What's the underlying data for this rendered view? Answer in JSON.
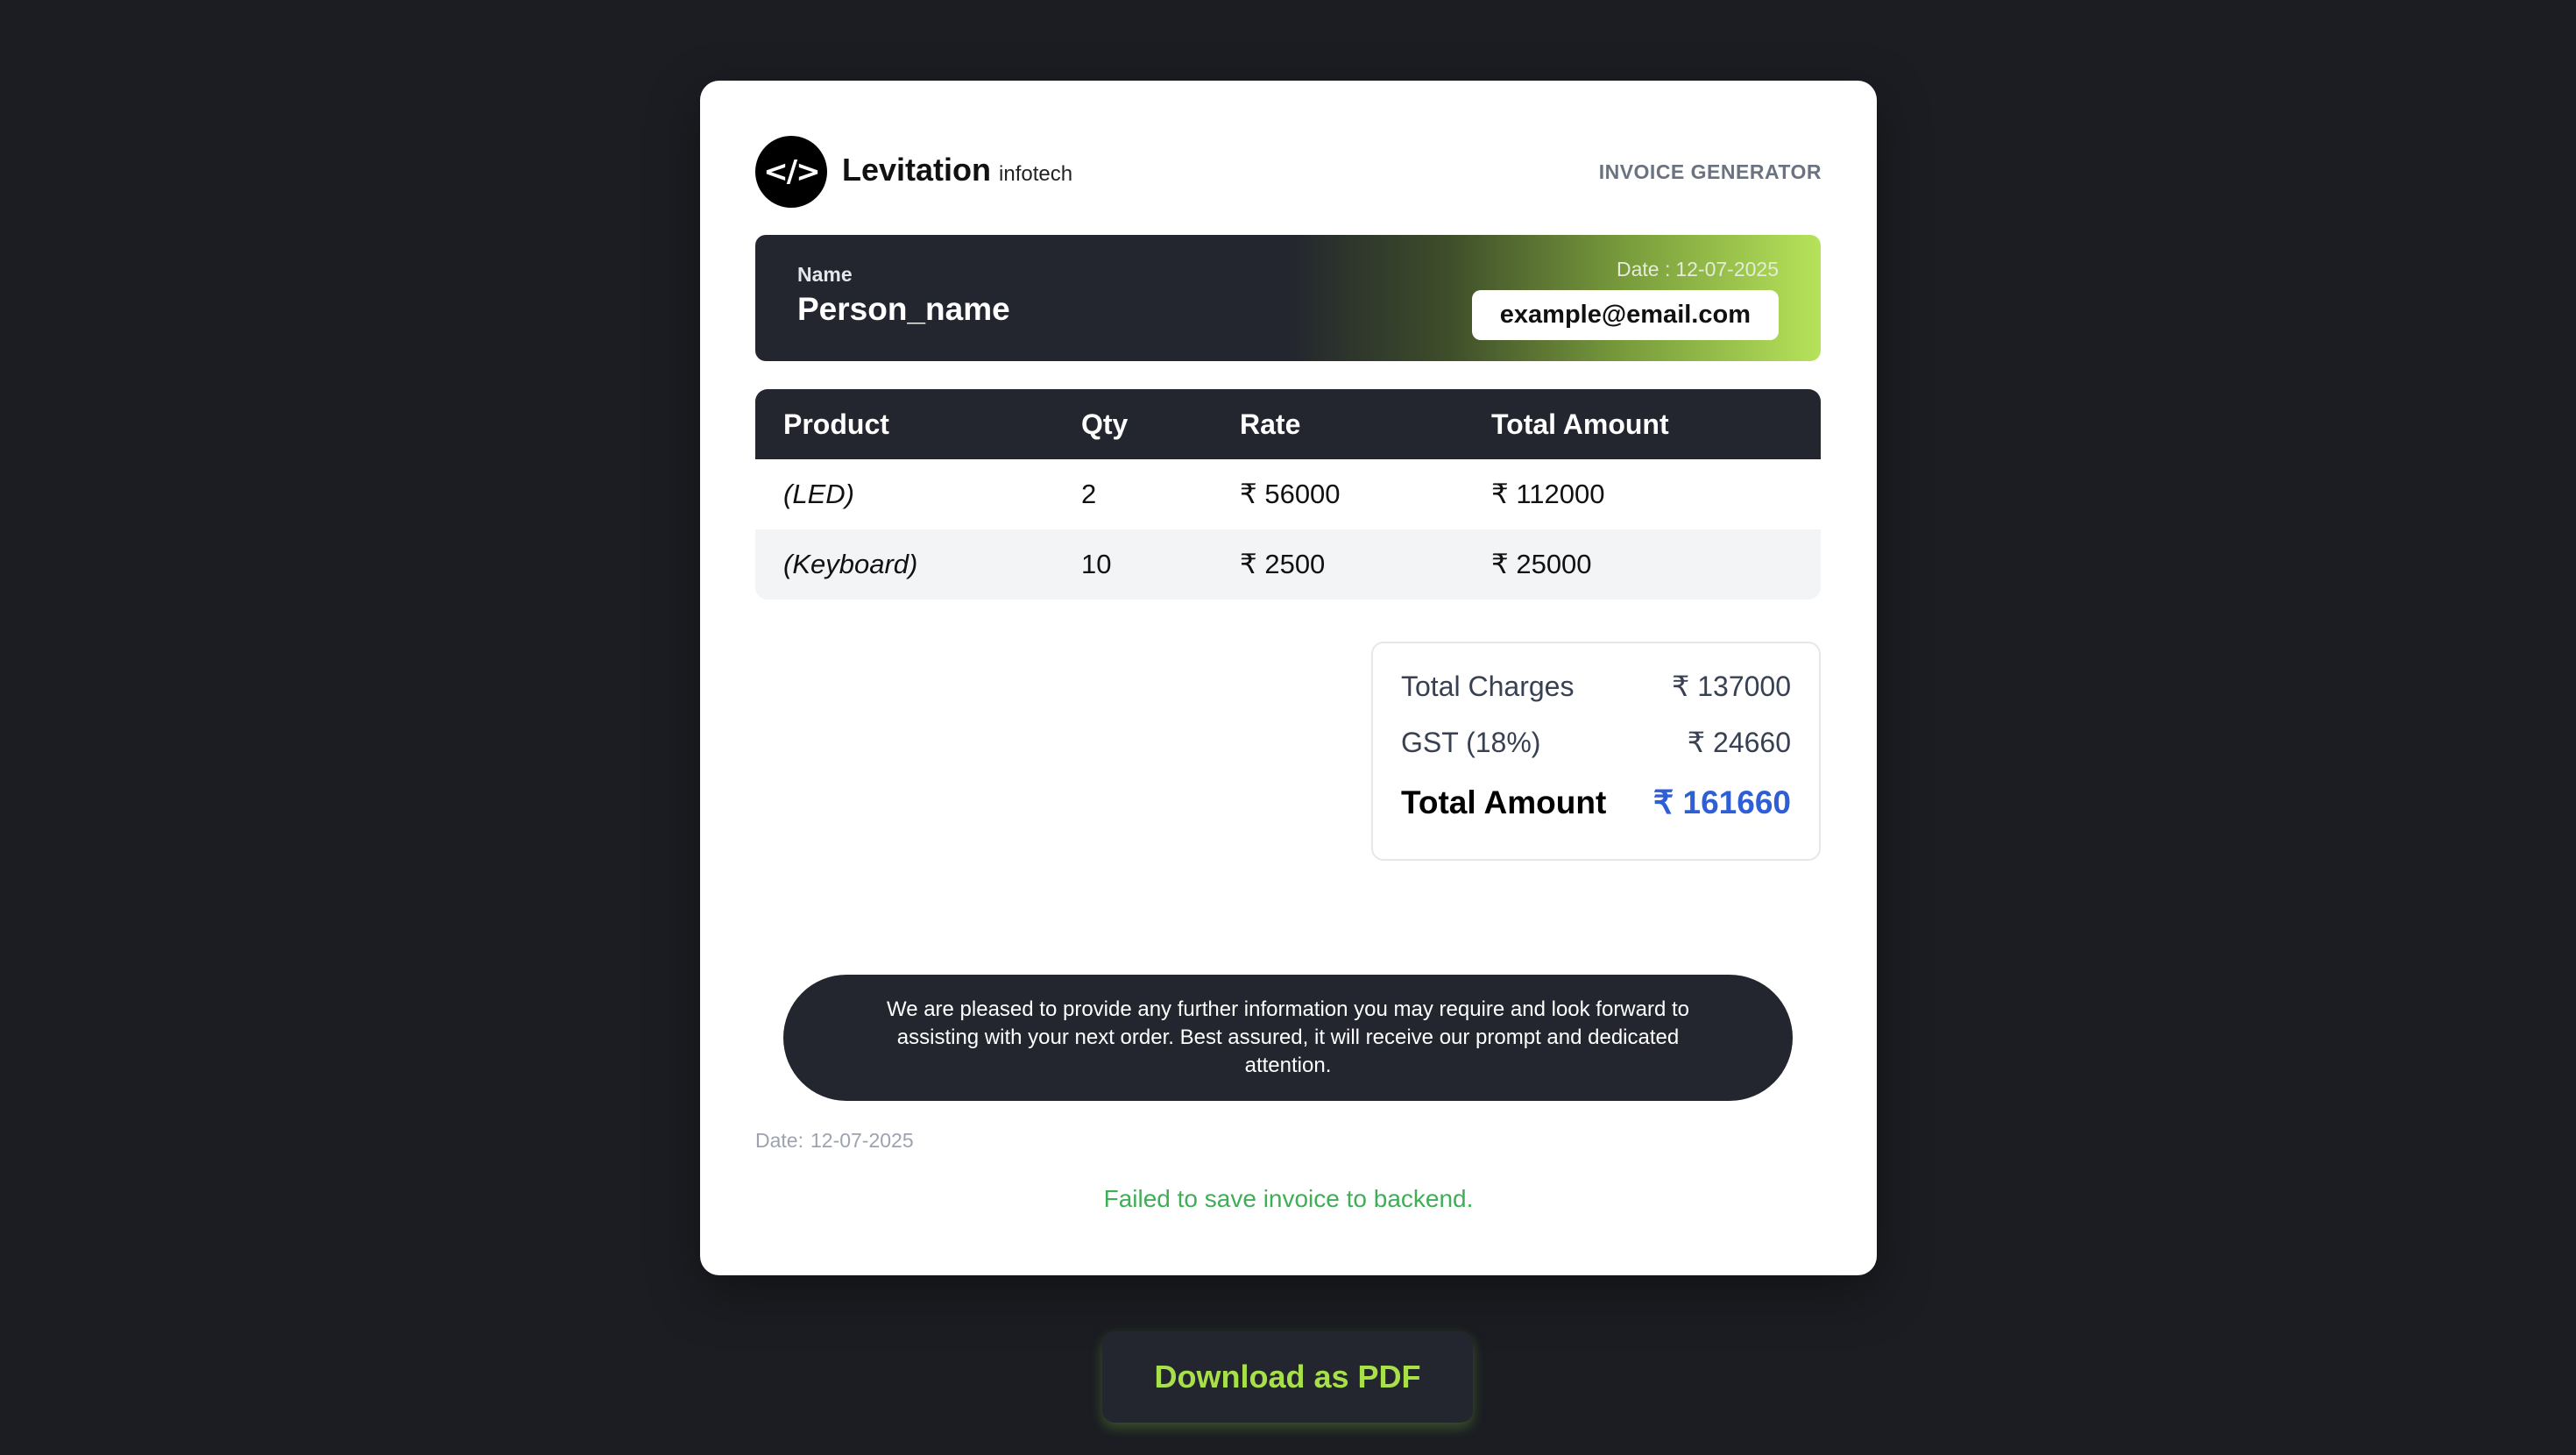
{
  "header": {
    "logo_glyph": "</>",
    "brand_name": "Levitation",
    "brand_sub": "infotech",
    "title": "INVOICE GENERATOR"
  },
  "customer": {
    "name_label": "Name",
    "name": "Person_name",
    "date_label": "Date :",
    "date": "12-07-2025",
    "email": "example@email.com"
  },
  "table": {
    "columns": [
      "Product",
      "Qty",
      "Rate",
      "Total Amount"
    ],
    "rows": [
      {
        "product": "(LED)",
        "qty": "2",
        "rate": "₹ 56000",
        "total": "₹ 112000"
      },
      {
        "product": "(Keyboard)",
        "qty": "10",
        "rate": "₹ 2500",
        "total": "₹ 25000"
      }
    ]
  },
  "summary": {
    "charges_label": "Total Charges",
    "charges_value": "₹ 137000",
    "gst_label": "GST (18%)",
    "gst_value": "₹ 24660",
    "total_label": "Total Amount",
    "total_value": "₹ 161660"
  },
  "note": "We are pleased to provide any further information you may require and look forward to assisting with your next order. Best assured, it will receive our prompt and dedicated attention.",
  "footer": {
    "date_label": "Date:",
    "date": "12-07-2025",
    "status": "Failed to save invoice to backend."
  },
  "actions": {
    "download_label": "Download as PDF"
  },
  "colors": {
    "background": "#1b1d22",
    "dark": "#23262e",
    "accent_green": "#a8e04a",
    "total_blue": "#2f5fd6",
    "status_green": "#3fae57"
  }
}
